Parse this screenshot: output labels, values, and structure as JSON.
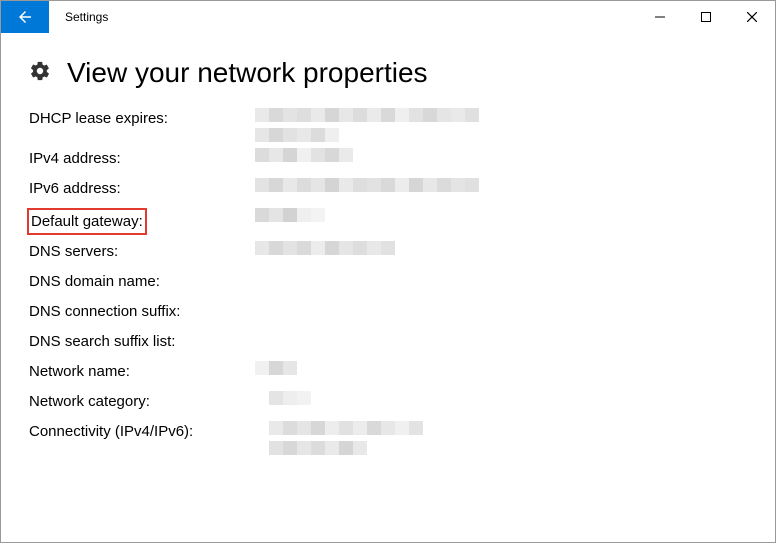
{
  "window": {
    "title": "Settings"
  },
  "page": {
    "heading": "View your network properties"
  },
  "props": {
    "dhcp_lease_expires": "DHCP lease expires:",
    "ipv4_address": "IPv4 address:",
    "ipv6_address": "IPv6 address:",
    "default_gateway": "Default gateway:",
    "dns_servers": "DNS servers:",
    "dns_domain_name": "DNS domain name:",
    "dns_connection_suffix": "DNS connection suffix:",
    "dns_search_suffix_list": "DNS search suffix list:",
    "network_name": "Network name:",
    "network_category": "Network category:",
    "connectivity": "Connectivity (IPv4/IPv6):"
  }
}
